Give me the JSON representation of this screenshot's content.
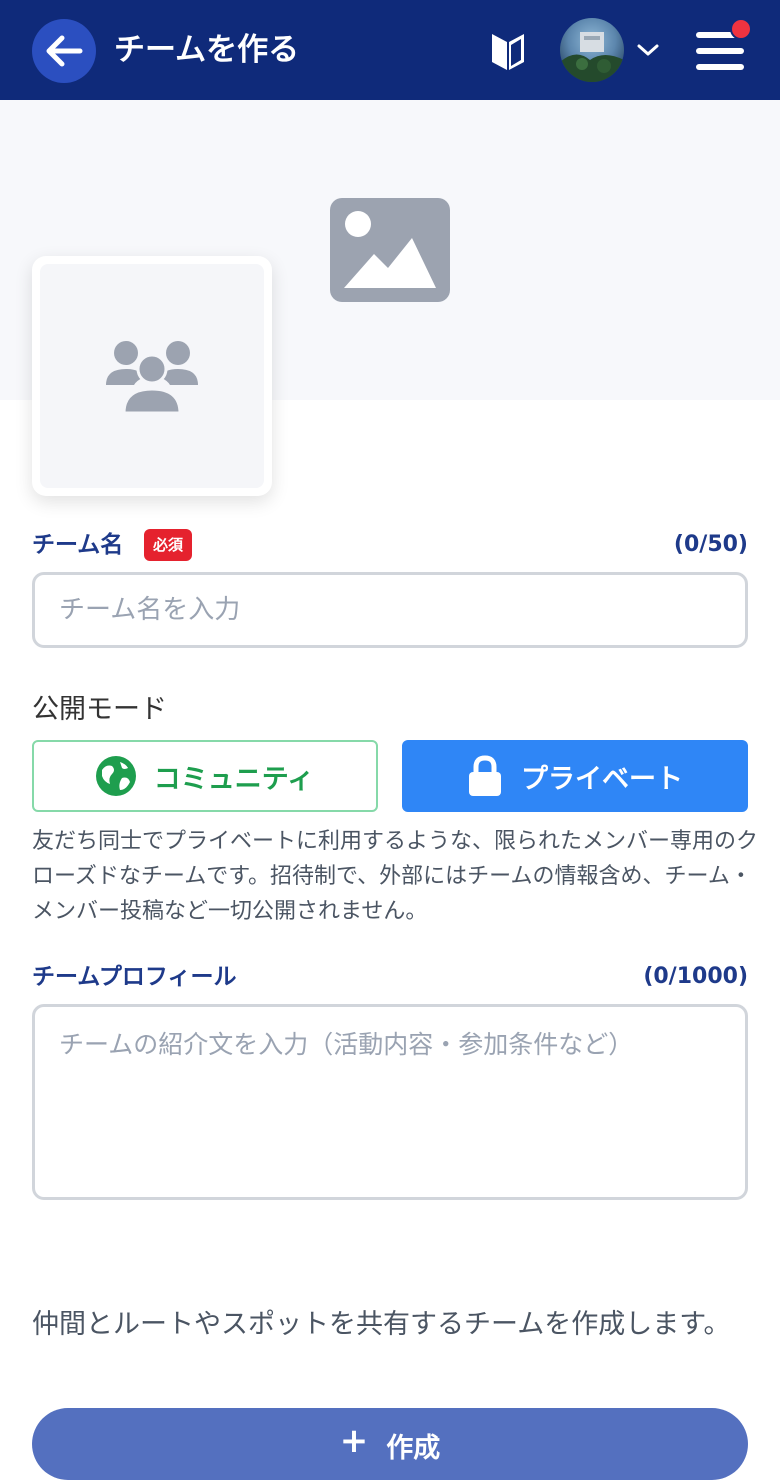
{
  "header": {
    "title": "チームを作る",
    "icons": [
      "back-arrow-icon",
      "beginner-mark-icon",
      "avatar",
      "chevron-down-icon",
      "hamburger-menu-icon"
    ],
    "notification_dot_color": "#ef3340",
    "background_color": "#0f2a7a"
  },
  "cover": {
    "icon": "image-placeholder-icon"
  },
  "team_icon": {
    "icon": "group-icon"
  },
  "team_name": {
    "label": "チーム名",
    "required_badge": "必須",
    "counter": "(0/50)",
    "placeholder": "チーム名を入力",
    "value": ""
  },
  "visibility": {
    "label": "公開モード",
    "options": [
      {
        "label": "コミュニティ",
        "icon": "globe-icon",
        "selected": false
      },
      {
        "label": "プライベート",
        "icon": "lock-icon",
        "selected": true
      }
    ],
    "description": "友だち同士でプライベートに利用するような、限られたメンバー専用のクローズドなチームです。招待制で、外部にはチームの情報含め、チーム・メンバー投稿など一切公開されません。"
  },
  "profile": {
    "label": "チームプロフィール",
    "counter": "(0/1000)",
    "placeholder": "チームの紹介文を入力（活動内容・参加条件など）",
    "value": ""
  },
  "footer": {
    "note": "仲間とルートやスポットを共有するチームを作成します。",
    "create_plus": "+",
    "create_label": "作成"
  },
  "colors": {
    "accent_blue": "#2f86f6",
    "community_green": "#1e9e4e",
    "required_red": "#e5222e",
    "label_navy": "#1e3a8a"
  }
}
